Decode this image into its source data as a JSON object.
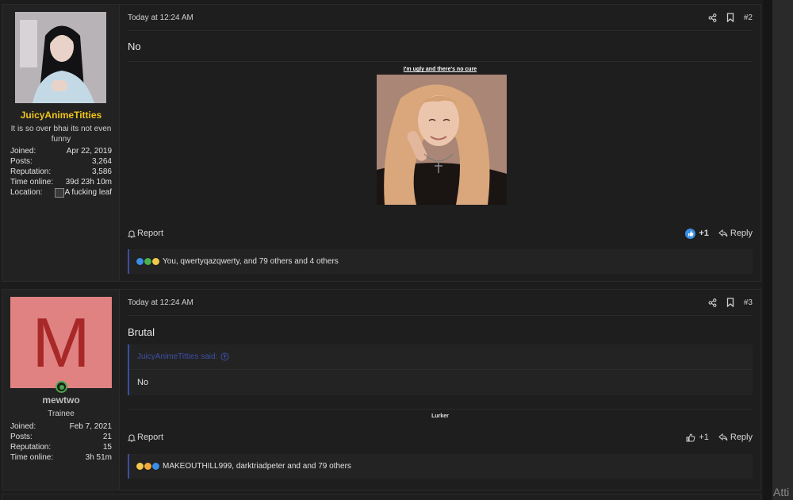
{
  "posts": [
    {
      "user": {
        "name": "JuicyAnimeTitties",
        "title": "It is so over bhai its not even funny",
        "stats": [
          {
            "label": "Joined:",
            "value": "Apr 22, 2019"
          },
          {
            "label": "Posts:",
            "value": "3,264"
          },
          {
            "label": "Reputation:",
            "value": "3,586"
          },
          {
            "label": "Time online:",
            "value": "39d 23h 10m"
          },
          {
            "label": "Location:",
            "value": "A fucking leaf"
          }
        ]
      },
      "time": "Today at 12:24 AM",
      "number": "#2",
      "message": "No",
      "signature_caption": "I'm ugly and there's no cure",
      "report": "Report",
      "likes": "+1",
      "reply": "Reply",
      "reactions_text": "You, qwertyqazqwerty, and 79 others and 4 others"
    },
    {
      "user": {
        "initial": "M",
        "name": "mewtwo",
        "title": "Trainee",
        "stats": [
          {
            "label": "Joined:",
            "value": "Feb 7, 2021"
          },
          {
            "label": "Posts:",
            "value": "21"
          },
          {
            "label": "Reputation:",
            "value": "15"
          },
          {
            "label": "Time online:",
            "value": "3h 51m"
          }
        ]
      },
      "time": "Today at 12:24 AM",
      "number": "#3",
      "message": "Brutal",
      "quote_author": "JuicyAnimeTitties said:",
      "quote_text": "No",
      "signature_text": "Lurker",
      "report": "Report",
      "likes": "+1",
      "reply": "Reply",
      "reactions_text": "MAKEOUTHILL999, darktriadpeter and and 79 others"
    }
  ],
  "edge_text": "Atti",
  "colors": {
    "background": "#1c1c1c",
    "username_gold": "#f0c419",
    "avatar_m_bg": "#e08282",
    "avatar_m_letter": "#a82828",
    "quote_accent": "#3b4fa0",
    "online": "#49a64a"
  },
  "icons": [
    "share-icon",
    "bookmark-icon",
    "bell-icon",
    "like-icon",
    "reply-icon",
    "quote-arrow-icon"
  ]
}
